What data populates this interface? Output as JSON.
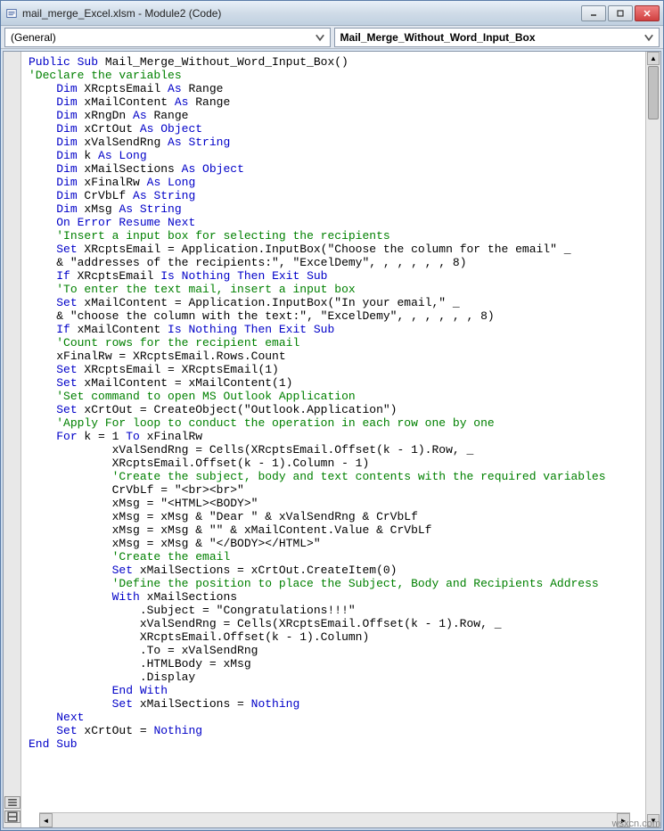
{
  "window": {
    "title": "mail_merge_Excel.xlsm - Module2 (Code)"
  },
  "dropdowns": {
    "left": "(General)",
    "right": "Mail_Merge_Without_Word_Input_Box"
  },
  "code": {
    "lines": [
      {
        "i": 0,
        "t": [
          {
            "c": "kw",
            "v": "Public Sub"
          },
          {
            "c": "",
            "v": " Mail_Merge_Without_Word_Input_Box()"
          }
        ]
      },
      {
        "i": 0,
        "t": [
          {
            "c": "cm",
            "v": "'Declare the variables"
          }
        ]
      },
      {
        "i": 1,
        "t": [
          {
            "c": "kw",
            "v": "Dim"
          },
          {
            "c": "",
            "v": " XRcptsEmail "
          },
          {
            "c": "kw",
            "v": "As"
          },
          {
            "c": "",
            "v": " Range"
          }
        ]
      },
      {
        "i": 1,
        "t": [
          {
            "c": "kw",
            "v": "Dim"
          },
          {
            "c": "",
            "v": " xMailContent "
          },
          {
            "c": "kw",
            "v": "As"
          },
          {
            "c": "",
            "v": " Range"
          }
        ]
      },
      {
        "i": 1,
        "t": [
          {
            "c": "kw",
            "v": "Dim"
          },
          {
            "c": "",
            "v": " xRngDn "
          },
          {
            "c": "kw",
            "v": "As"
          },
          {
            "c": "",
            "v": " Range"
          }
        ]
      },
      {
        "i": 1,
        "t": [
          {
            "c": "kw",
            "v": "Dim"
          },
          {
            "c": "",
            "v": " xCrtOut "
          },
          {
            "c": "kw",
            "v": "As Object"
          }
        ]
      },
      {
        "i": 1,
        "t": [
          {
            "c": "kw",
            "v": "Dim"
          },
          {
            "c": "",
            "v": " xValSendRng "
          },
          {
            "c": "kw",
            "v": "As String"
          }
        ]
      },
      {
        "i": 1,
        "t": [
          {
            "c": "kw",
            "v": "Dim"
          },
          {
            "c": "",
            "v": " k "
          },
          {
            "c": "kw",
            "v": "As Long"
          }
        ]
      },
      {
        "i": 1,
        "t": [
          {
            "c": "kw",
            "v": "Dim"
          },
          {
            "c": "",
            "v": " xMailSections "
          },
          {
            "c": "kw",
            "v": "As Object"
          }
        ]
      },
      {
        "i": 1,
        "t": [
          {
            "c": "kw",
            "v": "Dim"
          },
          {
            "c": "",
            "v": " xFinalRw "
          },
          {
            "c": "kw",
            "v": "As Long"
          }
        ]
      },
      {
        "i": 1,
        "t": [
          {
            "c": "kw",
            "v": "Dim"
          },
          {
            "c": "",
            "v": " CrVbLf "
          },
          {
            "c": "kw",
            "v": "As String"
          }
        ]
      },
      {
        "i": 1,
        "t": [
          {
            "c": "kw",
            "v": "Dim"
          },
          {
            "c": "",
            "v": " xMsg "
          },
          {
            "c": "kw",
            "v": "As String"
          }
        ]
      },
      {
        "i": 1,
        "t": [
          {
            "c": "kw",
            "v": "On Error Resume Next"
          }
        ]
      },
      {
        "i": 1,
        "t": [
          {
            "c": "cm",
            "v": "'Insert a input box for selecting the recipients"
          }
        ]
      },
      {
        "i": 1,
        "t": [
          {
            "c": "kw",
            "v": "Set"
          },
          {
            "c": "",
            "v": " XRcptsEmail = Application.InputBox(\"Choose the column for the email\" _"
          }
        ]
      },
      {
        "i": 1,
        "t": [
          {
            "c": "",
            "v": "& \"addresses of the recipients:\", \"ExcelDemy\", , , , , , 8)"
          }
        ]
      },
      {
        "i": 1,
        "t": [
          {
            "c": "kw",
            "v": "If"
          },
          {
            "c": "",
            "v": " XRcptsEmail "
          },
          {
            "c": "kw",
            "v": "Is Nothing Then Exit Sub"
          }
        ]
      },
      {
        "i": 1,
        "t": [
          {
            "c": "cm",
            "v": "'To enter the text mail, insert a input box"
          }
        ]
      },
      {
        "i": 1,
        "t": [
          {
            "c": "kw",
            "v": "Set"
          },
          {
            "c": "",
            "v": " xMailContent = Application.InputBox(\"In your email,\" _"
          }
        ]
      },
      {
        "i": 1,
        "t": [
          {
            "c": "",
            "v": "& \"choose the column with the text:\", \"ExcelDemy\", , , , , , 8)"
          }
        ]
      },
      {
        "i": 1,
        "t": [
          {
            "c": "kw",
            "v": "If"
          },
          {
            "c": "",
            "v": " xMailContent "
          },
          {
            "c": "kw",
            "v": "Is Nothing Then Exit Sub"
          }
        ]
      },
      {
        "i": 1,
        "t": [
          {
            "c": "cm",
            "v": "'Count rows for the recipient email"
          }
        ]
      },
      {
        "i": 1,
        "t": [
          {
            "c": "",
            "v": "xFinalRw = XRcptsEmail.Rows.Count"
          }
        ]
      },
      {
        "i": 1,
        "t": [
          {
            "c": "kw",
            "v": "Set"
          },
          {
            "c": "",
            "v": " XRcptsEmail = XRcptsEmail(1)"
          }
        ]
      },
      {
        "i": 1,
        "t": [
          {
            "c": "kw",
            "v": "Set"
          },
          {
            "c": "",
            "v": " xMailContent = xMailContent(1)"
          }
        ]
      },
      {
        "i": 1,
        "t": [
          {
            "c": "cm",
            "v": "'Set command to open MS Outlook Application"
          }
        ]
      },
      {
        "i": 1,
        "t": [
          {
            "c": "kw",
            "v": "Set"
          },
          {
            "c": "",
            "v": " xCrtOut = CreateObject(\"Outlook.Application\")"
          }
        ]
      },
      {
        "i": 1,
        "t": [
          {
            "c": "cm",
            "v": "'Apply For loop to conduct the operation in each row one by one"
          }
        ]
      },
      {
        "i": 1,
        "t": [
          {
            "c": "kw",
            "v": "For"
          },
          {
            "c": "",
            "v": " k = 1 "
          },
          {
            "c": "kw",
            "v": "To"
          },
          {
            "c": "",
            "v": " xFinalRw"
          }
        ]
      },
      {
        "i": 3,
        "t": [
          {
            "c": "",
            "v": "xValSendRng = Cells(XRcptsEmail.Offset(k - 1).Row, _"
          }
        ]
      },
      {
        "i": 3,
        "t": [
          {
            "c": "",
            "v": "XRcptsEmail.Offset(k - 1).Column - 1)"
          }
        ]
      },
      {
        "i": 3,
        "t": [
          {
            "c": "cm",
            "v": "'Create the subject, body and text contents with the required variables"
          }
        ]
      },
      {
        "i": 3,
        "t": [
          {
            "c": "",
            "v": "CrVbLf = \"<br><br>\""
          }
        ]
      },
      {
        "i": 3,
        "t": [
          {
            "c": "",
            "v": "xMsg = \"<HTML><BODY>\""
          }
        ]
      },
      {
        "i": 3,
        "t": [
          {
            "c": "",
            "v": "xMsg = xMsg & \"Dear \" & xValSendRng & CrVbLf"
          }
        ]
      },
      {
        "i": 3,
        "t": [
          {
            "c": "",
            "v": "xMsg = xMsg & \"\" & xMailContent.Value & CrVbLf"
          }
        ]
      },
      {
        "i": 3,
        "t": [
          {
            "c": "",
            "v": "xMsg = xMsg & \"</BODY></HTML>\""
          }
        ]
      },
      {
        "i": 3,
        "t": [
          {
            "c": "cm",
            "v": "'Create the email"
          }
        ]
      },
      {
        "i": 3,
        "t": [
          {
            "c": "kw",
            "v": "Set"
          },
          {
            "c": "",
            "v": " xMailSections = xCrtOut.CreateItem(0)"
          }
        ]
      },
      {
        "i": 3,
        "t": [
          {
            "c": "cm",
            "v": "'Define the position to place the Subject, Body and Recipients Address"
          }
        ]
      },
      {
        "i": 3,
        "t": [
          {
            "c": "kw",
            "v": "With"
          },
          {
            "c": "",
            "v": " xMailSections"
          }
        ]
      },
      {
        "i": 4,
        "t": [
          {
            "c": "",
            "v": ".Subject = \"Congratulations!!!\""
          }
        ]
      },
      {
        "i": 4,
        "t": [
          {
            "c": "",
            "v": "xValSendRng = Cells(XRcptsEmail.Offset(k - 1).Row, _"
          }
        ]
      },
      {
        "i": 4,
        "t": [
          {
            "c": "",
            "v": "XRcptsEmail.Offset(k - 1).Column)"
          }
        ]
      },
      {
        "i": 4,
        "t": [
          {
            "c": "",
            "v": ".To = xValSendRng"
          }
        ]
      },
      {
        "i": 4,
        "t": [
          {
            "c": "",
            "v": ".HTMLBody = xMsg"
          }
        ]
      },
      {
        "i": 4,
        "t": [
          {
            "c": "",
            "v": ".Display"
          }
        ]
      },
      {
        "i": 3,
        "t": [
          {
            "c": "kw",
            "v": "End With"
          }
        ]
      },
      {
        "i": 3,
        "t": [
          {
            "c": "kw",
            "v": "Set"
          },
          {
            "c": "",
            "v": " xMailSections = "
          },
          {
            "c": "kw",
            "v": "Nothing"
          }
        ]
      },
      {
        "i": 1,
        "t": [
          {
            "c": "kw",
            "v": "Next"
          }
        ]
      },
      {
        "i": 1,
        "t": [
          {
            "c": "kw",
            "v": "Set"
          },
          {
            "c": "",
            "v": " xCrtOut = "
          },
          {
            "c": "kw",
            "v": "Nothing"
          }
        ]
      },
      {
        "i": 0,
        "t": [
          {
            "c": "kw",
            "v": "End Sub"
          }
        ]
      }
    ]
  },
  "watermark": "wsxcn.com"
}
